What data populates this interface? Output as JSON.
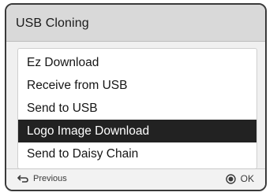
{
  "header": {
    "title": "USB Cloning"
  },
  "menu": {
    "items": [
      {
        "label": "Ez Download",
        "selected": false
      },
      {
        "label": "Receive from USB",
        "selected": false
      },
      {
        "label": "Send to USB",
        "selected": false
      },
      {
        "label": "Logo Image Download",
        "selected": true
      },
      {
        "label": "Send to Daisy Chain",
        "selected": false
      }
    ]
  },
  "footer": {
    "previous_label": "Previous",
    "previous_icon": "return-arrow-icon",
    "ok_label": "OK",
    "ok_icon": "ok-circle-icon"
  },
  "colors": {
    "selected_bg": "#222222",
    "header_bg": "#d9d9d9",
    "panel_bg": "#f0f0f0"
  }
}
